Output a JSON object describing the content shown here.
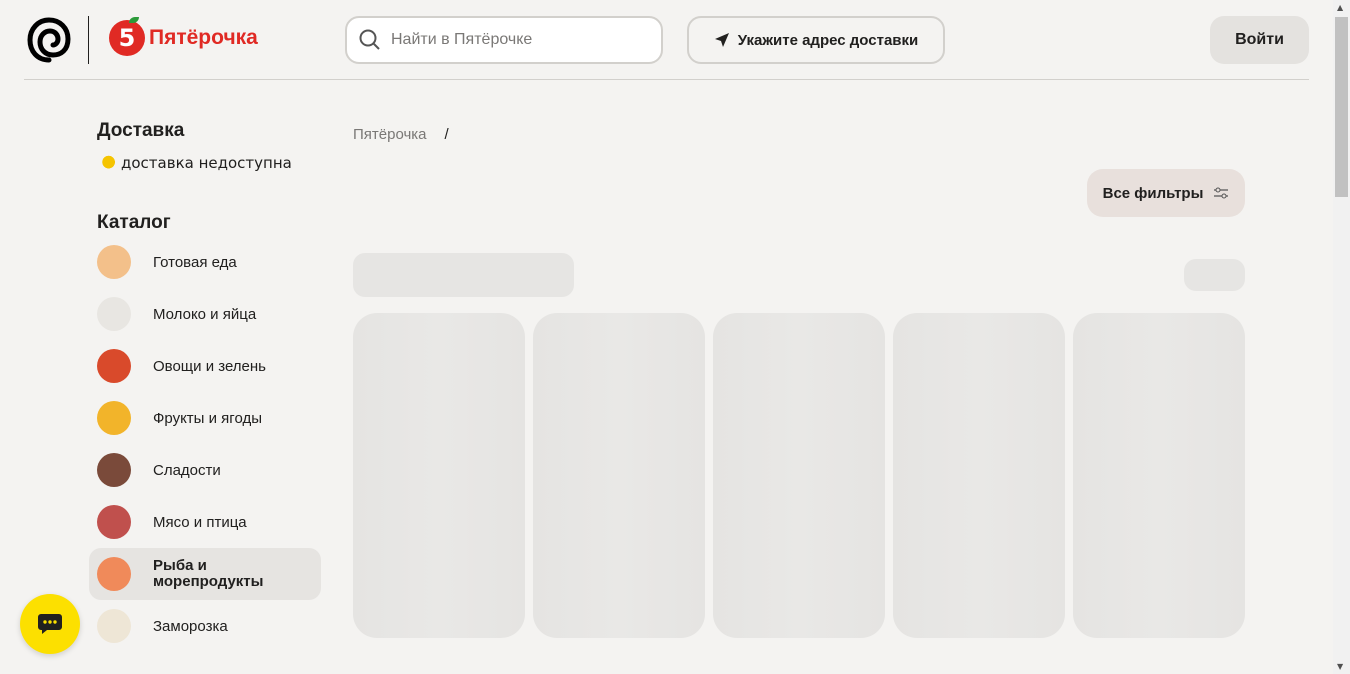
{
  "header": {
    "brand": "Пятёрочка",
    "search_placeholder": "Найти в Пятёрочке",
    "address_button": "Укажите адрес доставки",
    "login_button": "Войти"
  },
  "sidebar": {
    "delivery_title": "Доставка",
    "delivery_status": "доставка недоступна",
    "catalog_title": "Каталог",
    "categories": [
      {
        "label": "Готовая еда",
        "color": "#f3c08a"
      },
      {
        "label": "Молоко и яйца",
        "color": "#e8e6e2"
      },
      {
        "label": "Овощи и зелень",
        "color": "#d94a2b"
      },
      {
        "label": "Фрукты и ягоды",
        "color": "#f2b42a"
      },
      {
        "label": "Сладости",
        "color": "#7a4a3a"
      },
      {
        "label": "Мясо и птица",
        "color": "#c0504d"
      },
      {
        "label": "Рыба и морепродукты",
        "color": "#f08a5a"
      },
      {
        "label": "Заморозка",
        "color": "#eee6d6"
      }
    ]
  },
  "breadcrumb": {
    "root": "Пятёрочка",
    "sep": "/"
  },
  "filters_button": "Все фильтры"
}
